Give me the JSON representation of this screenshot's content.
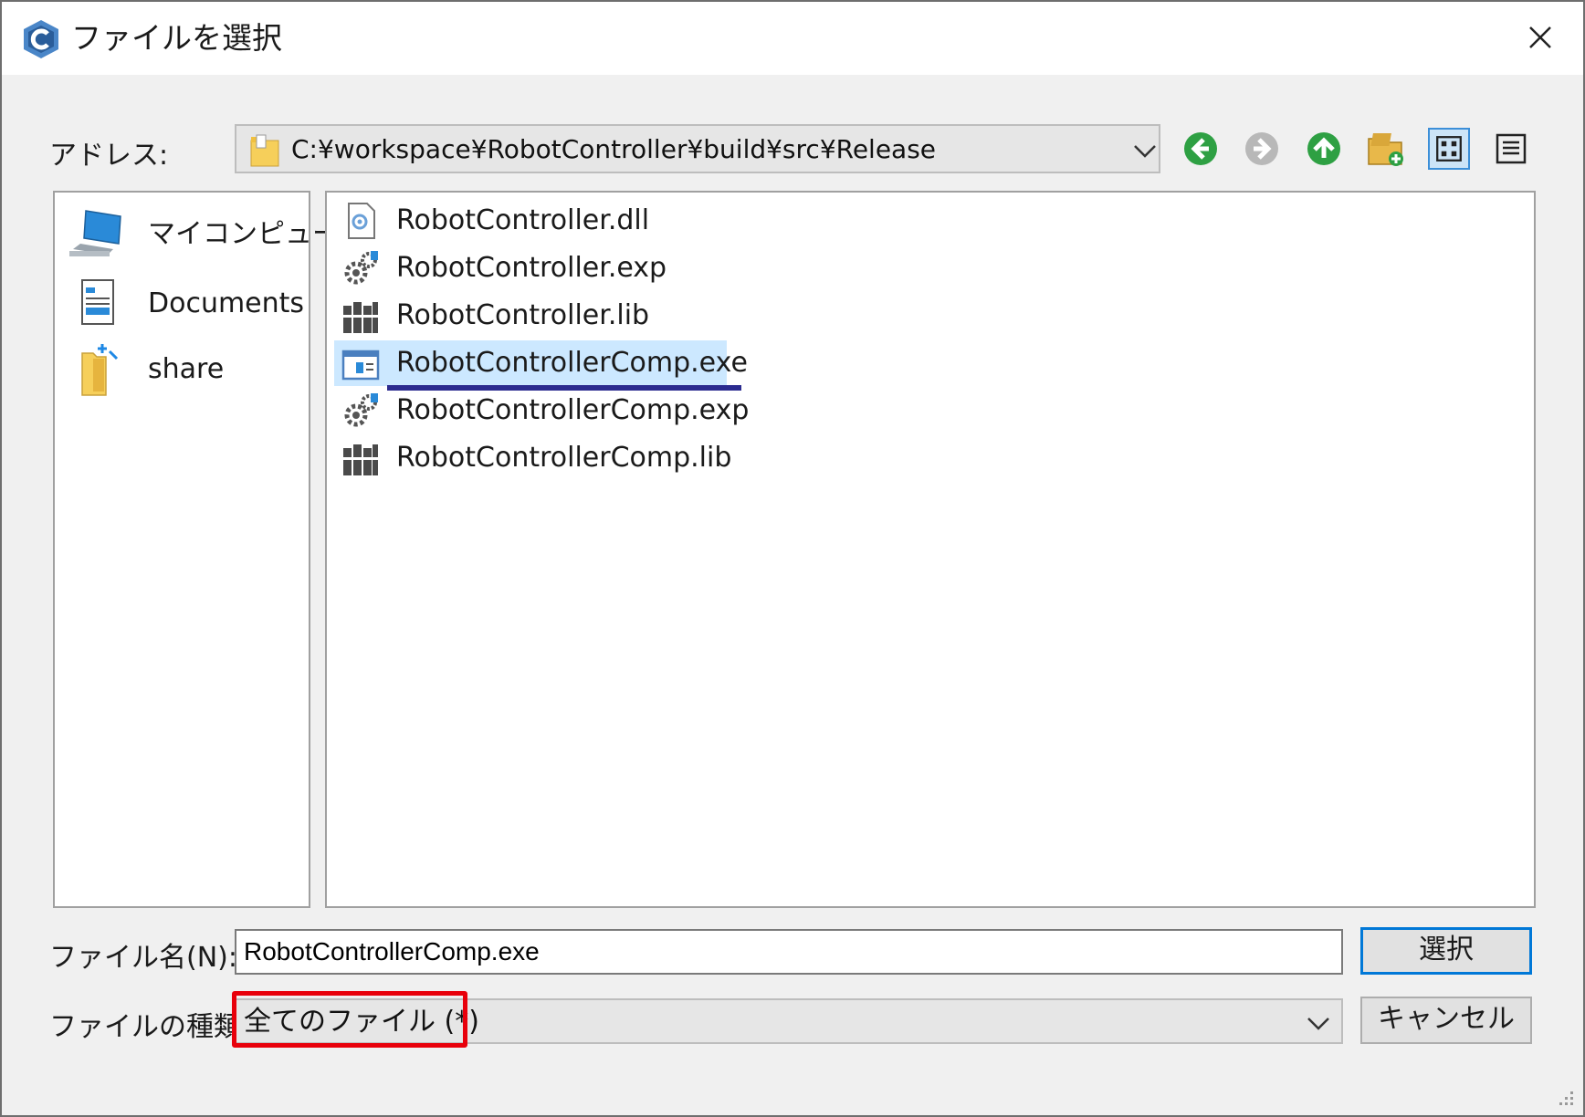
{
  "window": {
    "title": "ファイルを選択"
  },
  "address": {
    "label": "アドレス:",
    "path": "C:¥workspace¥RobotController¥build¥src¥Release"
  },
  "toolbar": {
    "buttons": [
      "back-icon",
      "forward-icon",
      "up-icon",
      "new-folder-icon",
      "icon-view-icon",
      "list-view-icon"
    ]
  },
  "places": [
    {
      "label": "マイコンピュータ",
      "icon": "computer-icon"
    },
    {
      "label": "Documents",
      "icon": "documents-icon"
    },
    {
      "label": "share",
      "icon": "shared-folder-icon"
    }
  ],
  "files": [
    {
      "name": "RobotController.dll",
      "icon": "dll-file-icon"
    },
    {
      "name": "RobotController.exp",
      "icon": "exp-file-icon"
    },
    {
      "name": "RobotController.lib",
      "icon": "lib-file-icon"
    },
    {
      "name": "RobotControllerComp.exe",
      "icon": "exe-file-icon",
      "selected": true
    },
    {
      "name": "RobotControllerComp.exp",
      "icon": "exp-file-icon"
    },
    {
      "name": "RobotControllerComp.lib",
      "icon": "lib-file-icon"
    }
  ],
  "filename": {
    "label": "ファイル名(N):",
    "value": "RobotControllerComp.exe"
  },
  "filetype": {
    "label": "ファイルの種類:",
    "value": "全てのファイル (*)"
  },
  "buttons": {
    "select": "選択",
    "cancel": "キャンセル"
  },
  "colors": {
    "selection": "#cce8ff",
    "accent": "#0078d7",
    "annotation_box": "#e8000b",
    "annotation_underline": "#2b2b8f"
  }
}
